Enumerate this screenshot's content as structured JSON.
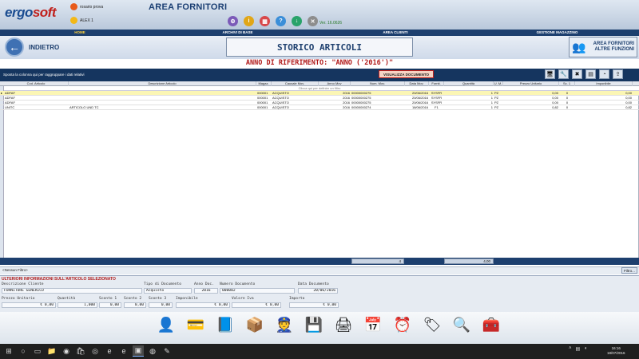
{
  "app": {
    "logo_a": "ergo",
    "logo_b": "soft",
    "title": "AREA FORNITORI",
    "user1": "rosario prova",
    "user2": "ALEX 1",
    "version": "Ver. 16.0626"
  },
  "menu": [
    "HOME",
    "ARCHIVI DI BASE",
    "AREA CLIENTI",
    "GESTIONE MAGAZZINO"
  ],
  "header": {
    "back_label": "INDIETRO",
    "page_title": "STORICO ARTICOLI",
    "other_fn_line1": "AREA FORNITORI",
    "other_fn_line2": "ALTRE FUNZIONI",
    "subtitle": "ANNO DI RIFERIMENTO: \"ANNO ('2016')\""
  },
  "grid": {
    "group_hint": "Sposta la colonna qui per raggruppare i dati relativi",
    "view_doc_button": "VISUALIZZA DOCUMENTO",
    "filter_hint": "Clicca qui per definire un filtro",
    "columns": [
      "Cod. Articolo",
      "Descrizione Articolo",
      "Magaz.",
      "Causale Mov.",
      "Anno Mov",
      "Num. Mov.",
      "Data Mov.",
      "Fornit.",
      "Quantità",
      "U. M.",
      "Prezzo Unitario",
      "Sc. 1",
      "Imponibile"
    ],
    "rows": [
      [
        "ADFAF",
        "",
        "000001",
        "ACQUISTO",
        "2016",
        "00000000275",
        "20/06/2016",
        "SYSFR",
        "1",
        "PZ",
        "0,00",
        "0",
        "0,00"
      ],
      [
        "ADFAF",
        "",
        "000001",
        "ACQUISTO",
        "2016",
        "00000000275",
        "20/06/2016",
        "SYSFR",
        "1",
        "PZ",
        "0,00",
        "0",
        "0,00"
      ],
      [
        "ADFAF",
        "",
        "000001",
        "ACQUISTO",
        "2016",
        "00000000275",
        "20/06/2016",
        "SYSFR",
        "1",
        "PZ",
        "0,00",
        "0",
        "0,00"
      ],
      [
        "UNITC",
        "ARTICOLO UND TC",
        "000001",
        "ACQUISTO",
        "2016",
        "00000000274",
        "18/06/2016",
        "F1",
        "1",
        "PZ",
        "0,82",
        "0",
        "0,82"
      ]
    ],
    "summary_count": "4",
    "summary_qty": "4,00",
    "no_filter": "<Nessun Filtro>",
    "filter_button": "Filtro..."
  },
  "details": {
    "title": "ULTERIORI INFORMAZIONI SULL'ARTICOLO SELEZIONATO",
    "descrizione_cliente_label": "Descrizione Cliente",
    "descrizione_cliente": "FORNITORE GENERICO",
    "tipo_documento_label": "Tipo di Documento",
    "tipo_documento": "Acquisto",
    "anno_doc_label": "Anno Doc.",
    "anno_doc": "2016",
    "numero_doc_label": "Numero Documento",
    "numero_doc": "000002",
    "data_doc_label": "Data Documento",
    "data_doc": "20/06/2016",
    "prezzo_label": "Prezzo Unitario",
    "prezzo": "€ 0,00",
    "quantita_label": "Quantità",
    "quantita": "1,000",
    "sconto1_label": "Sconto 1",
    "sconto1": "0,00",
    "sconto2_label": "Sconto 2",
    "sconto2": "0,00",
    "sconto3_label": "Sconto 3",
    "sconto3": "0,00",
    "imponibile_label": "Imponibile",
    "imponibile": "€ 0,00",
    "iva_label": "Valore Iva",
    "iva": "€ 0,00",
    "importo_label": "Importo",
    "importo": "€ 0,00"
  },
  "taskbar": {
    "time": "16:16",
    "date": "18/07/2016"
  },
  "colors": {
    "navy": "#1d3f6e",
    "accent_red": "#b01818",
    "selected_row": "#fbf6b4"
  }
}
